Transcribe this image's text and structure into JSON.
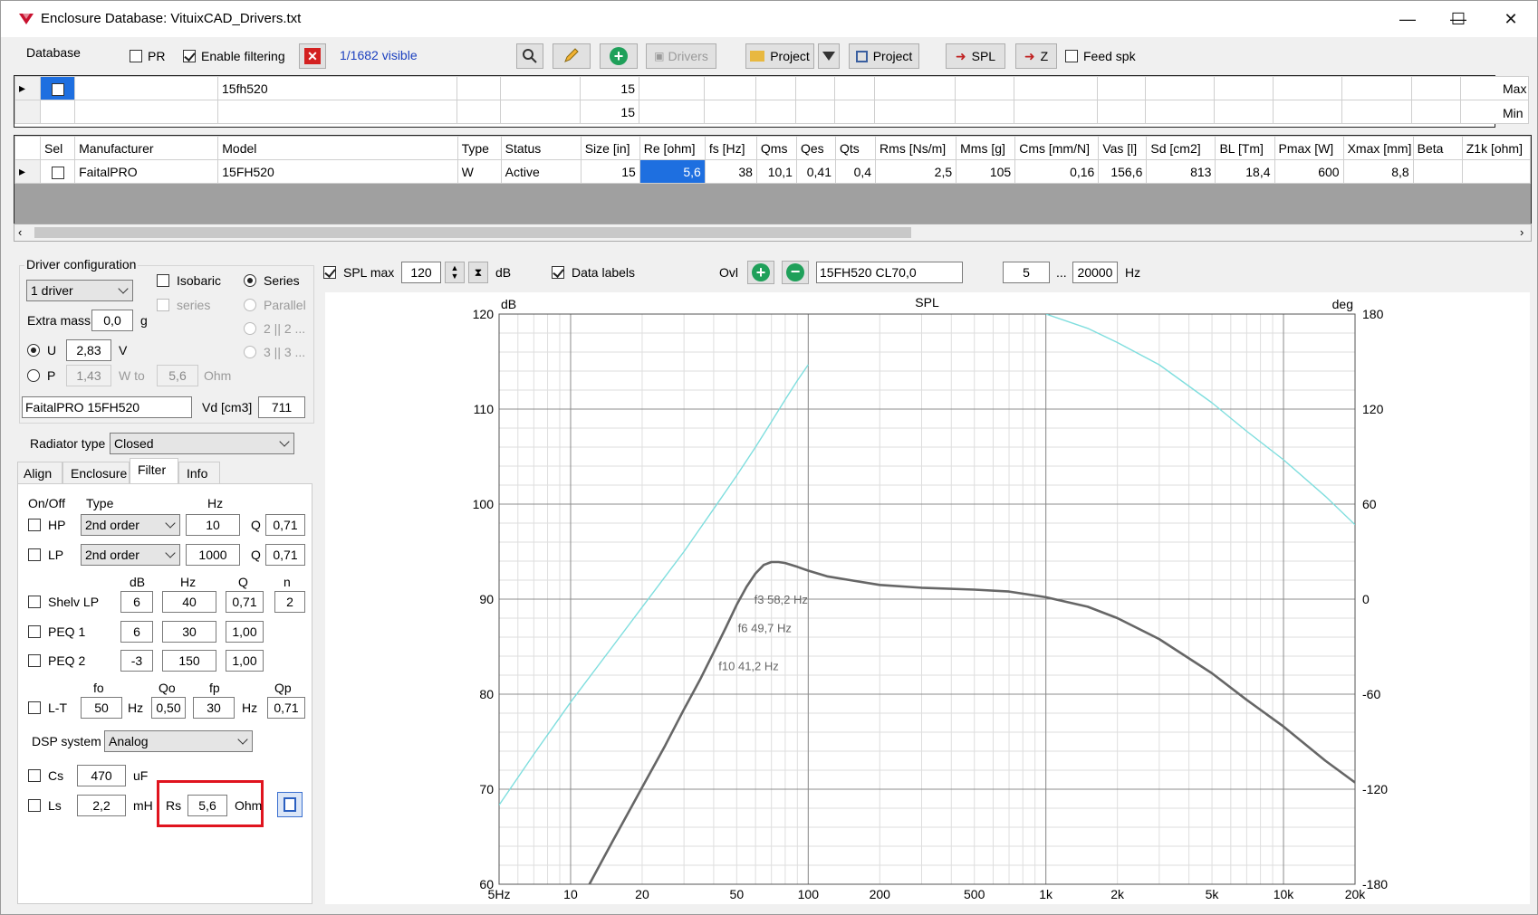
{
  "window": {
    "title": "Enclosure  Database: VituixCAD_Drivers.txt",
    "minimize": "—",
    "maximize": "☐",
    "close": "✕"
  },
  "toolbar": {
    "database": "Database",
    "pr": "PR",
    "enable_filtering": "Enable filtering",
    "visible_count": "1/1682 visible",
    "drivers": "Drivers",
    "project1": "Project",
    "project2": "Project",
    "spl": "SPL",
    "z": "Z",
    "feed_spk": "Feed spk"
  },
  "filter_rows": {
    "max_label": "Max",
    "min_label": "Min",
    "max_model": "15fh520",
    "max_size": "15",
    "min_size": "15"
  },
  "columns": [
    "Sel",
    "Manufacturer",
    "Model",
    "Type",
    "Status",
    "Size [in]",
    "Re [ohm]",
    "fs [Hz]",
    "Qms",
    "Qes",
    "Qts",
    "Rms [Ns/m]",
    "Mms [g]",
    "Cms [mm/N]",
    "Vas [l]",
    "Sd [cm2]",
    "BL [Tm]",
    "Pmax [W]",
    "Xmax [mm]",
    "Beta",
    "Z1k [ohm]"
  ],
  "driver_row": {
    "manufacturer": "FaitalPRO",
    "model": "15FH520",
    "type": "W",
    "status": "Active",
    "size": "15",
    "re": "5,6",
    "fs": "38",
    "qms": "10,1",
    "qes": "0,41",
    "qts": "0,4",
    "rms": "2,5",
    "mms": "105",
    "cms": "0,16",
    "vas": "156,6",
    "sd": "813",
    "bl": "18,4",
    "pmax": "600",
    "xmax": "8,8",
    "beta": "",
    "z1k": ""
  },
  "driver_config": {
    "title": "Driver configuration",
    "count": "1 driver",
    "isobaric": "Isobaric",
    "series_chk": "series",
    "series": "Series",
    "parallel": "Parallel",
    "p22": "2 || 2 ...",
    "p33": "3 || 3 ...",
    "extra_mass_label": "Extra mass",
    "extra_mass": "0,0",
    "g": "g",
    "u_label": "U",
    "u_value": "2,83",
    "v": "V",
    "p_label": "P",
    "p_value": "1,43",
    "w_to": "W to",
    "ohm_value": "5,6",
    "ohm": "Ohm",
    "driver_name": "FaitalPRO 15FH520",
    "vd_label": "Vd [cm3]",
    "vd_value": "711"
  },
  "radiator": {
    "label": "Radiator type",
    "value": "Closed"
  },
  "tabs": [
    "Align",
    "Enclosure",
    "Filter",
    "Info"
  ],
  "filter": {
    "onoff": "On/Off",
    "type": "Type",
    "hz": "Hz",
    "hp": "HP",
    "hp_type": "2nd order",
    "hp_hz": "10",
    "q": "Q",
    "hp_q": "0,71",
    "lp": "LP",
    "lp_type": "2nd order",
    "lp_hz": "1000",
    "lp_q": "0,71",
    "db": "dB",
    "hz2": "Hz",
    "q2": "Q",
    "n": "n",
    "shelv": "Shelv LP",
    "shelv_db": "6",
    "shelv_hz": "40",
    "shelv_q": "0,71",
    "shelv_n": "2",
    "peq1": "PEQ 1",
    "peq1_db": "6",
    "peq1_hz": "30",
    "peq1_q": "1,00",
    "peq2": "PEQ 2",
    "peq2_db": "-3",
    "peq2_hz": "150",
    "peq2_q": "1,00",
    "fo": "fo",
    "qo": "Qo",
    "fp": "fp",
    "qp": "Qp",
    "lt": "L-T",
    "lt_fo": "50",
    "lt_hz1": "Hz",
    "lt_qo": "0,50",
    "lt_fp": "30",
    "lt_hz2": "Hz",
    "lt_qp": "0,71",
    "dsp_label": "DSP system",
    "dsp_value": "Analog",
    "cs": "Cs",
    "cs_value": "470",
    "uf": "uF",
    "ls": "Ls",
    "ls_value": "2,2",
    "mh": "mH",
    "rs": "Rs",
    "rs_value": "5,6",
    "rs_unit": "Ohm"
  },
  "chart_controls": {
    "spl_max": "SPL max",
    "spl_max_value": "120",
    "db": "dB",
    "data_labels": "Data labels",
    "ovl": "Ovl",
    "overlay_name": "15FH520 CL70,0",
    "f_min": "5",
    "ellipsis": "...",
    "f_max": "20000",
    "hz": "Hz"
  },
  "chart_data": {
    "type": "line",
    "title": "SPL",
    "ylabel_left": "dB",
    "ylabel_right": "deg",
    "xscale": "log",
    "xlim": [
      5,
      20000
    ],
    "ylim": [
      60,
      120
    ],
    "y2lim": [
      -180,
      180
    ],
    "xticks": [
      "5Hz",
      "10",
      "20",
      "50",
      "100",
      "200",
      "500",
      "1k",
      "2k",
      "5k",
      "10k",
      "20k"
    ],
    "xtick_values": [
      5,
      10,
      20,
      50,
      100,
      200,
      500,
      1000,
      2000,
      5000,
      10000,
      20000
    ],
    "yticks": [
      60,
      70,
      80,
      90,
      100,
      110,
      120
    ],
    "y2ticks": [
      -180,
      -120,
      -60,
      0,
      60,
      120,
      180
    ],
    "grid": true,
    "series": [
      {
        "axis": "left",
        "color": "#666666",
        "x": [
          12,
          15,
          20,
          25,
          30,
          35,
          40,
          45,
          50,
          55,
          60,
          65,
          70,
          75,
          80,
          90,
          100,
          120,
          150,
          200,
          300,
          500,
          700,
          1000,
          1500,
          2000,
          3000,
          5000,
          7000,
          10000,
          15000,
          20000
        ],
        "y": [
          60,
          64.5,
          70.2,
          74.6,
          78.4,
          81.5,
          84.4,
          87,
          89.4,
          91.3,
          92.7,
          93.6,
          93.9,
          93.9,
          93.8,
          93.4,
          93,
          92.4,
          92,
          91.5,
          91.2,
          91,
          90.8,
          90.2,
          89.2,
          88,
          85.8,
          82.2,
          79.4,
          76.6,
          73,
          70.7
        ]
      },
      {
        "axis": "right",
        "color": "#7fdede",
        "x": [
          5,
          7,
          10,
          15,
          20,
          30,
          40,
          50,
          60,
          70,
          80,
          90,
          100
        ],
        "y": [
          -130,
          -98,
          -65,
          -30,
          -5,
          30,
          57,
          78,
          96,
          112,
          126,
          138,
          148
        ]
      },
      {
        "axis": "right",
        "color": "#7fdede",
        "x": [
          1000,
          1500,
          2000,
          3000,
          5000,
          7000,
          10000,
          15000,
          20000
        ],
        "y": [
          180,
          171,
          162,
          148,
          124,
          106,
          88,
          65,
          47
        ]
      }
    ],
    "annotations": [
      {
        "text": "f3 58,2 Hz",
        "x": 58.2,
        "y": 90
      },
      {
        "text": "f6 49,7 Hz",
        "x": 49.7,
        "y": 87
      },
      {
        "text": "f10 41,2 Hz",
        "x": 41.2,
        "y": 83
      }
    ]
  }
}
